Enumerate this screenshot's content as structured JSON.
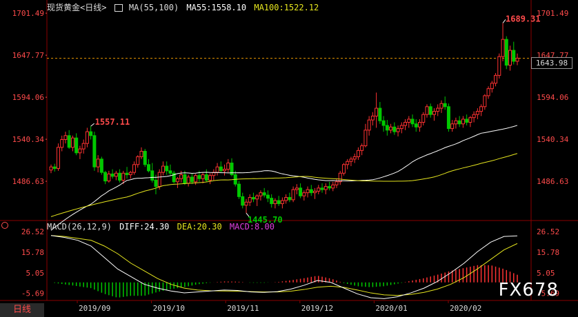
{
  "header": {
    "instrument": "现货黄金<日线>",
    "ma_label": "MA(55,100)",
    "ma55_label": "MA55:1558.10",
    "ma100_label": "MA100:1522.12"
  },
  "macd_header": {
    "label": "MACD(26,12,9)",
    "diff_label": "DIFF:24.30",
    "dea_label": "DEA:20.30",
    "macd_label": "MACD:8.00"
  },
  "period_tab": "日线",
  "current_price_box": "1643.98",
  "watermark": "FX678",
  "colors": {
    "up": "#ff3232",
    "down": "#00c800",
    "ma55": "#ffffff",
    "ma100": "#e6e61e",
    "diff": "#ffffff",
    "dea": "#e6e61e",
    "macd_text": "#e040e0",
    "axis_label": "#ff4b4b",
    "date_label": "#dcdcdc",
    "grid": "#8b0000"
  },
  "chart_data": [
    {
      "type": "candlestick",
      "title": "现货黄金<日线>",
      "ylim": [
        1440,
        1706
      ],
      "price_ticks": [
        "1701.49",
        "1647.77",
        "1594.06",
        "1540.34",
        "1486.63"
      ],
      "x_ticks": [
        "2019/09",
        "2019/10",
        "2019/11",
        "2019/12",
        "2020/01",
        "2020/02"
      ],
      "annotations": [
        {
          "text": "1557.11",
          "type": "high"
        },
        {
          "text": "1445.70",
          "type": "low"
        },
        {
          "text": "1689.31",
          "type": "high"
        }
      ],
      "current_price": 1643.98,
      "candles": [
        [
          1501,
          1508,
          1497,
          1505
        ],
        [
          1505,
          1509,
          1499,
          1503
        ],
        [
          1503,
          1535,
          1500,
          1530
        ],
        [
          1530,
          1545,
          1525,
          1540
        ],
        [
          1540,
          1550,
          1535,
          1545
        ],
        [
          1545,
          1552,
          1528,
          1530
        ],
        [
          1530,
          1545,
          1525,
          1542
        ],
        [
          1542,
          1548,
          1520,
          1523
        ],
        [
          1523,
          1532,
          1515,
          1528
        ],
        [
          1528,
          1540,
          1522,
          1535
        ],
        [
          1535,
          1555,
          1530,
          1550
        ],
        [
          1550,
          1557,
          1540,
          1545
        ],
        [
          1545,
          1550,
          1500,
          1505
        ],
        [
          1505,
          1520,
          1498,
          1515
        ],
        [
          1515,
          1518,
          1495,
          1498
        ],
        [
          1498,
          1500,
          1483,
          1487
        ],
        [
          1487,
          1500,
          1485,
          1496
        ],
        [
          1496,
          1502,
          1490,
          1493
        ],
        [
          1493,
          1500,
          1488,
          1497
        ],
        [
          1497,
          1502,
          1485,
          1488
        ],
        [
          1488,
          1500,
          1483,
          1497
        ],
        [
          1497,
          1505,
          1490,
          1495
        ],
        [
          1495,
          1500,
          1490,
          1498
        ],
        [
          1498,
          1512,
          1495,
          1508
        ],
        [
          1508,
          1520,
          1504,
          1518
        ],
        [
          1518,
          1530,
          1515,
          1525
        ],
        [
          1525,
          1528,
          1505,
          1508
        ],
        [
          1508,
          1515,
          1498,
          1500
        ],
        [
          1500,
          1510,
          1485,
          1488
        ],
        [
          1488,
          1495,
          1470,
          1480
        ],
        [
          1480,
          1502,
          1476,
          1498
        ],
        [
          1498,
          1512,
          1494,
          1506
        ],
        [
          1506,
          1512,
          1495,
          1500
        ],
        [
          1500,
          1508,
          1494,
          1497
        ],
        [
          1497,
          1500,
          1484,
          1486
        ],
        [
          1486,
          1492,
          1478,
          1490
        ],
        [
          1490,
          1500,
          1485,
          1495
        ],
        [
          1495,
          1500,
          1482,
          1484
        ],
        [
          1484,
          1495,
          1480,
          1492
        ],
        [
          1492,
          1497,
          1483,
          1486
        ],
        [
          1486,
          1496,
          1482,
          1494
        ],
        [
          1494,
          1500,
          1486,
          1490
        ],
        [
          1490,
          1498,
          1484,
          1495
        ],
        [
          1495,
          1502,
          1486,
          1488
        ],
        [
          1488,
          1497,
          1483,
          1494
        ],
        [
          1494,
          1502,
          1488,
          1498
        ],
        [
          1498,
          1510,
          1494,
          1505
        ],
        [
          1505,
          1512,
          1498,
          1500
        ],
        [
          1500,
          1508,
          1494,
          1502
        ],
        [
          1502,
          1515,
          1498,
          1510
        ],
        [
          1510,
          1516,
          1493,
          1495
        ],
        [
          1495,
          1500,
          1480,
          1483
        ],
        [
          1483,
          1487,
          1464,
          1467
        ],
        [
          1467,
          1472,
          1452,
          1456
        ],
        [
          1456,
          1464,
          1446,
          1460
        ],
        [
          1460,
          1470,
          1455,
          1466
        ],
        [
          1466,
          1472,
          1460,
          1464
        ],
        [
          1464,
          1470,
          1455,
          1468
        ],
        [
          1468,
          1475,
          1462,
          1472
        ],
        [
          1472,
          1478,
          1466,
          1469
        ],
        [
          1469,
          1475,
          1460,
          1465
        ],
        [
          1465,
          1470,
          1453,
          1458
        ],
        [
          1458,
          1465,
          1452,
          1462
        ],
        [
          1462,
          1468,
          1455,
          1458
        ],
        [
          1458,
          1466,
          1452,
          1462
        ],
        [
          1462,
          1470,
          1458,
          1466
        ],
        [
          1466,
          1472,
          1460,
          1463
        ],
        [
          1463,
          1480,
          1460,
          1476
        ],
        [
          1476,
          1483,
          1470,
          1478
        ],
        [
          1478,
          1484,
          1465,
          1468
        ],
        [
          1468,
          1475,
          1462,
          1472
        ],
        [
          1472,
          1480,
          1466,
          1476
        ],
        [
          1476,
          1482,
          1468,
          1472
        ],
        [
          1472,
          1478,
          1464,
          1474
        ],
        [
          1474,
          1482,
          1470,
          1478
        ],
        [
          1478,
          1484,
          1472,
          1476
        ],
        [
          1476,
          1484,
          1470,
          1480
        ],
        [
          1480,
          1486,
          1475,
          1478
        ],
        [
          1478,
          1486,
          1474,
          1482
        ],
        [
          1482,
          1490,
          1478,
          1486
        ],
        [
          1486,
          1500,
          1482,
          1497
        ],
        [
          1497,
          1510,
          1494,
          1508
        ],
        [
          1508,
          1515,
          1502,
          1512
        ],
        [
          1512,
          1518,
          1506,
          1515
        ],
        [
          1515,
          1522,
          1510,
          1518
        ],
        [
          1518,
          1530,
          1514,
          1526
        ],
        [
          1526,
          1535,
          1520,
          1532
        ],
        [
          1532,
          1560,
          1530,
          1552
        ],
        [
          1552,
          1570,
          1545,
          1565
        ],
        [
          1565,
          1575,
          1558,
          1570
        ],
        [
          1570,
          1600,
          1555,
          1580
        ],
        [
          1580,
          1588,
          1560,
          1564
        ],
        [
          1564,
          1570,
          1550,
          1558
        ],
        [
          1558,
          1565,
          1545,
          1552
        ],
        [
          1552,
          1560,
          1548,
          1556
        ],
        [
          1556,
          1562,
          1546,
          1550
        ],
        [
          1550,
          1558,
          1544,
          1554
        ],
        [
          1554,
          1562,
          1548,
          1558
        ],
        [
          1558,
          1566,
          1552,
          1562
        ],
        [
          1562,
          1570,
          1555,
          1566
        ],
        [
          1566,
          1572,
          1556,
          1560
        ],
        [
          1560,
          1566,
          1550,
          1556
        ],
        [
          1556,
          1566,
          1550,
          1562
        ],
        [
          1562,
          1575,
          1558,
          1572
        ],
        [
          1572,
          1585,
          1568,
          1582
        ],
        [
          1582,
          1586,
          1568,
          1572
        ],
        [
          1572,
          1580,
          1564,
          1576
        ],
        [
          1576,
          1585,
          1570,
          1580
        ],
        [
          1580,
          1590,
          1574,
          1586
        ],
        [
          1586,
          1595,
          1578,
          1582
        ],
        [
          1582,
          1586,
          1550,
          1554
        ],
        [
          1554,
          1565,
          1550,
          1560
        ],
        [
          1560,
          1568,
          1554,
          1564
        ],
        [
          1564,
          1570,
          1556,
          1560
        ],
        [
          1560,
          1570,
          1555,
          1566
        ],
        [
          1566,
          1572,
          1558,
          1562
        ],
        [
          1562,
          1570,
          1556,
          1568
        ],
        [
          1568,
          1576,
          1562,
          1572
        ],
        [
          1572,
          1580,
          1566,
          1576
        ],
        [
          1576,
          1585,
          1570,
          1582
        ],
        [
          1582,
          1598,
          1578,
          1596
        ],
        [
          1596,
          1608,
          1592,
          1605
        ],
        [
          1605,
          1615,
          1600,
          1612
        ],
        [
          1612,
          1625,
          1608,
          1622
        ],
        [
          1622,
          1650,
          1618,
          1646
        ],
        [
          1646,
          1689,
          1640,
          1668
        ],
        [
          1668,
          1672,
          1630,
          1635
        ],
        [
          1635,
          1660,
          1628,
          1654
        ],
        [
          1654,
          1665,
          1636,
          1640
        ],
        [
          1640,
          1650,
          1635,
          1644
        ]
      ],
      "ma55_start": 1420,
      "ma55_end": 1558.1,
      "ma100_start": 1440,
      "ma100_end": 1522.12
    },
    {
      "type": "macd",
      "title": "MACD(26,12,9)",
      "ylim": [
        -8,
        28
      ],
      "ticks": [
        "26.52",
        "15.78",
        "5.05",
        "-5.69"
      ],
      "diff": [
        24.5,
        23.5,
        22,
        19,
        13,
        7,
        3,
        -1,
        -3,
        -4.5,
        -5.5,
        -5,
        -4.5,
        -4,
        -4.2,
        -5,
        -5.2,
        -4.8,
        -3.5,
        -1.5,
        1,
        0,
        -3,
        -6,
        -8,
        -8.5,
        -7.5,
        -5.5,
        -3,
        0.5,
        5,
        10,
        16,
        21,
        24,
        24.3
      ],
      "dea": [
        24.5,
        24,
        23,
        22,
        19,
        15,
        10,
        6,
        2,
        -1,
        -3,
        -4,
        -4.4,
        -4.5,
        -4.6,
        -4.8,
        -5,
        -5,
        -4.6,
        -3.7,
        -2.5,
        -2,
        -2.6,
        -4,
        -5.5,
        -6.5,
        -6.8,
        -6.3,
        -5.2,
        -3.5,
        -1,
        2.5,
        7,
        12,
        17,
        20.3
      ],
      "hist": [
        0,
        -1,
        -2,
        -3,
        -6,
        -8,
        -7,
        -7,
        -5,
        -3.5,
        -2.5,
        -1,
        -0.1,
        0.5,
        0.4,
        -0.2,
        -0.2,
        0.2,
        1.1,
        2.2,
        3.5,
        2,
        -0.4,
        -2,
        -2.5,
        -2,
        -0.7,
        0.8,
        2.2,
        4,
        6,
        7.5,
        9,
        9,
        7,
        4
      ]
    }
  ]
}
